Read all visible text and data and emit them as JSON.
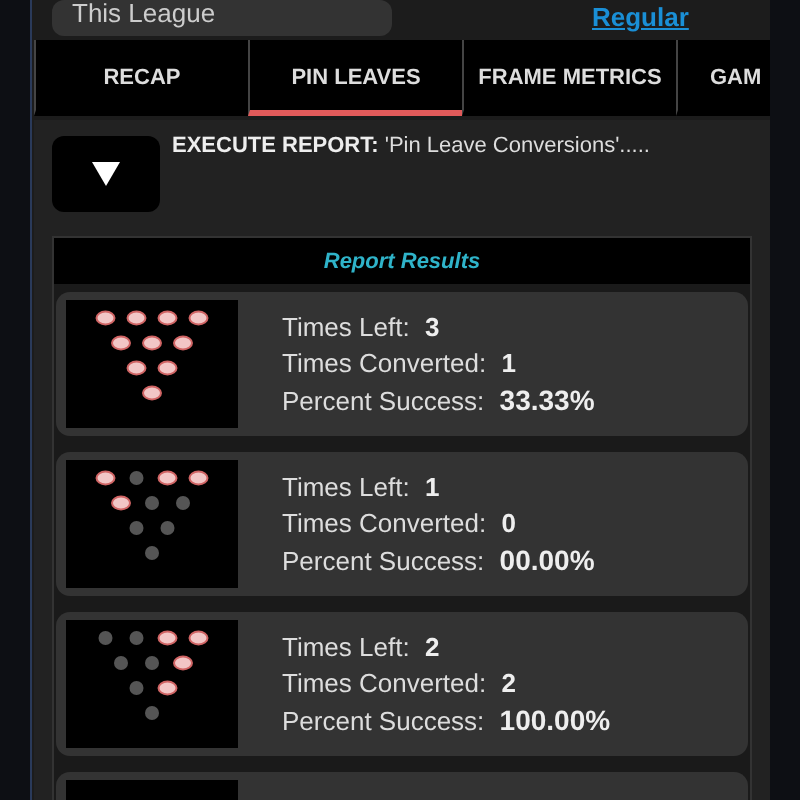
{
  "filter": {
    "value": "This League",
    "link": "Regular"
  },
  "tabs": [
    {
      "label": "RECAP",
      "selected": false
    },
    {
      "label": "PIN LEAVES",
      "selected": true
    },
    {
      "label": "FRAME METRICS",
      "selected": false
    },
    {
      "label": "GAM",
      "selected": false
    }
  ],
  "execute": {
    "label": "EXECUTE REPORT:",
    "report": "'Pin Leave Conversions'....."
  },
  "results_title": "Report Results",
  "results": [
    {
      "kind": "full",
      "pins": [
        [
          true,
          true,
          true,
          true
        ],
        [
          true,
          true,
          true
        ],
        [
          true,
          true
        ],
        [
          true
        ]
      ],
      "stats": [
        {
          "label": "Times Left:",
          "value": "3"
        },
        {
          "label": "Times Converted:",
          "value": "1"
        },
        {
          "label": "Percent Success:",
          "value": "33.33%"
        }
      ]
    },
    {
      "kind": "full",
      "pins": [
        [
          true,
          false,
          true,
          true
        ],
        [
          true,
          false,
          false
        ],
        [
          false,
          false
        ],
        [
          false
        ]
      ],
      "stats": [
        {
          "label": "Times Left:",
          "value": "1"
        },
        {
          "label": "Times Converted:",
          "value": "0"
        },
        {
          "label": "Percent Success:",
          "value": "00.00%"
        }
      ]
    },
    {
      "kind": "full",
      "pins": [
        [
          false,
          false,
          true,
          true
        ],
        [
          false,
          false,
          true
        ],
        [
          false,
          true
        ],
        [
          false
        ]
      ],
      "stats": [
        {
          "label": "Times Left:",
          "value": "2"
        },
        {
          "label": "Times Converted:",
          "value": "2"
        },
        {
          "label": "Percent Success:",
          "value": "100.00%"
        }
      ]
    },
    {
      "kind": "cut"
    }
  ]
}
